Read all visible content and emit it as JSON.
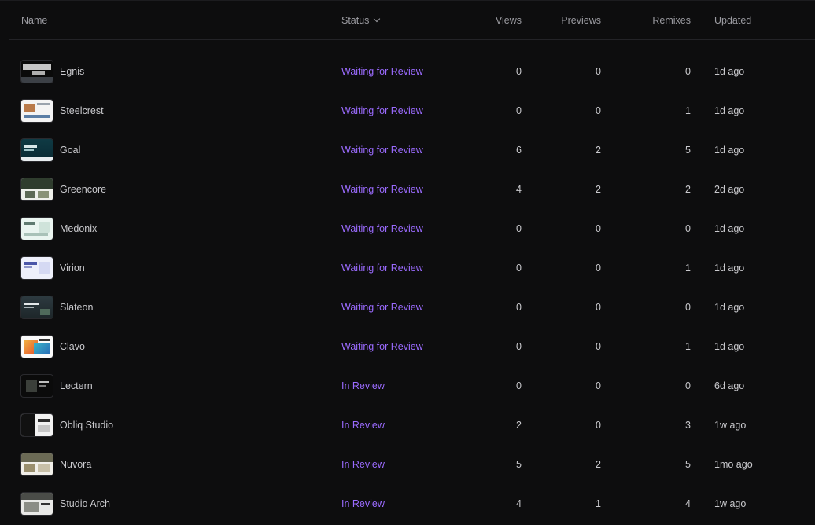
{
  "header": {
    "name": "Name",
    "status": "Status",
    "views": "Views",
    "previews": "Previews",
    "remixes": "Remixes",
    "updated": "Updated"
  },
  "rows": [
    {
      "name": "Egnis",
      "status": "Waiting for Review",
      "views": "0",
      "previews": "0",
      "remixes": "0",
      "updated": "1d ago"
    },
    {
      "name": "Steelcrest",
      "status": "Waiting for Review",
      "views": "0",
      "previews": "0",
      "remixes": "1",
      "updated": "1d ago"
    },
    {
      "name": "Goal",
      "status": "Waiting for Review",
      "views": "6",
      "previews": "2",
      "remixes": "5",
      "updated": "1d ago"
    },
    {
      "name": "Greencore",
      "status": "Waiting for Review",
      "views": "4",
      "previews": "2",
      "remixes": "2",
      "updated": "2d ago"
    },
    {
      "name": "Medonix",
      "status": "Waiting for Review",
      "views": "0",
      "previews": "0",
      "remixes": "0",
      "updated": "1d ago"
    },
    {
      "name": "Virion",
      "status": "Waiting for Review",
      "views": "0",
      "previews": "0",
      "remixes": "1",
      "updated": "1d ago"
    },
    {
      "name": "Slateon",
      "status": "Waiting for Review",
      "views": "0",
      "previews": "0",
      "remixes": "0",
      "updated": "1d ago"
    },
    {
      "name": "Clavo",
      "status": "Waiting for Review",
      "views": "0",
      "previews": "0",
      "remixes": "1",
      "updated": "1d ago"
    },
    {
      "name": "Lectern",
      "status": "In Review",
      "views": "0",
      "previews": "0",
      "remixes": "0",
      "updated": "6d ago"
    },
    {
      "name": "Obliq Studio",
      "status": "In Review",
      "views": "2",
      "previews": "0",
      "remixes": "3",
      "updated": "1w ago"
    },
    {
      "name": "Nuvora",
      "status": "In Review",
      "views": "5",
      "previews": "2",
      "remixes": "5",
      "updated": "1mo ago"
    },
    {
      "name": "Studio Arch",
      "status": "In Review",
      "views": "4",
      "previews": "1",
      "remixes": "4",
      "updated": "1w ago"
    }
  ],
  "colors": {
    "background": "#0d0d0e",
    "status_accent": "#9b6bff",
    "header_text": "#9b9ba1",
    "body_text": "#c9c9cd"
  }
}
